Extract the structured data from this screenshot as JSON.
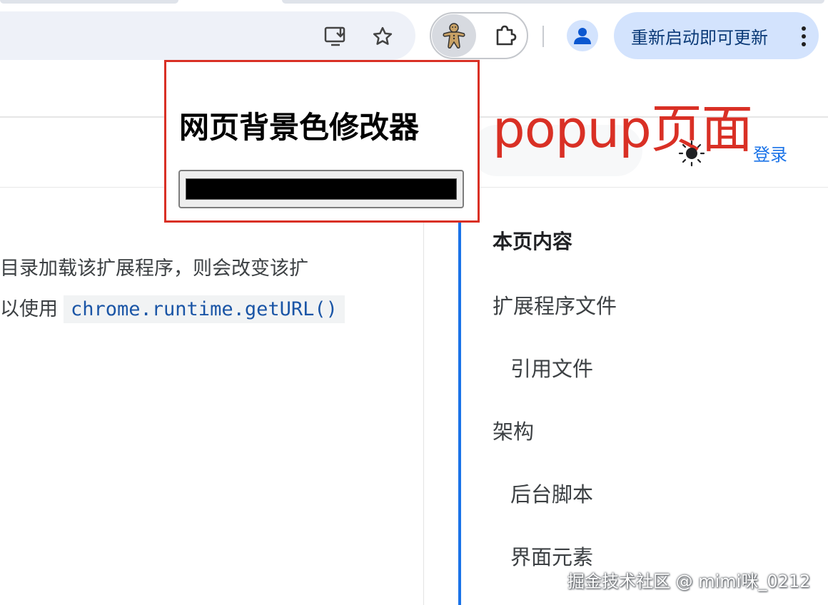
{
  "toolbar": {
    "install_icon": "install-app-icon",
    "bookmark_icon": "star-icon",
    "active_extension_icon": "gingerbread-man-icon",
    "extensions_icon": "puzzle-piece-icon",
    "profile_icon": "person-icon",
    "update_button_label": "重新启动即可更新",
    "menu_icon": "kebab-menu-icon"
  },
  "header": {
    "login_label": "登录",
    "theme_icon": "sun-icon"
  },
  "annotation": {
    "label": "popup页面",
    "color": "#d93025"
  },
  "content": {
    "paragraph_line1": "目录加载该扩展程序，则会改变该扩",
    "paragraph_line2_prefix": "以使用",
    "code_snippet": "chrome.runtime.getURL()"
  },
  "toc": {
    "heading": "本页内容",
    "items": [
      {
        "label": "扩展程序文件"
      },
      {
        "label": "引用文件"
      },
      {
        "label": "架构"
      },
      {
        "label": "后台脚本"
      },
      {
        "label": "界面元素"
      }
    ]
  },
  "popup": {
    "title": "网页背景色修改器",
    "color_value": "#000000"
  },
  "watermark": {
    "text": "掘金技术社区 @ mimi咪_0212"
  },
  "colors": {
    "accent": "#1a73e8",
    "update_pill_bg": "#d3e3fd",
    "annotation_red": "#d93025"
  }
}
